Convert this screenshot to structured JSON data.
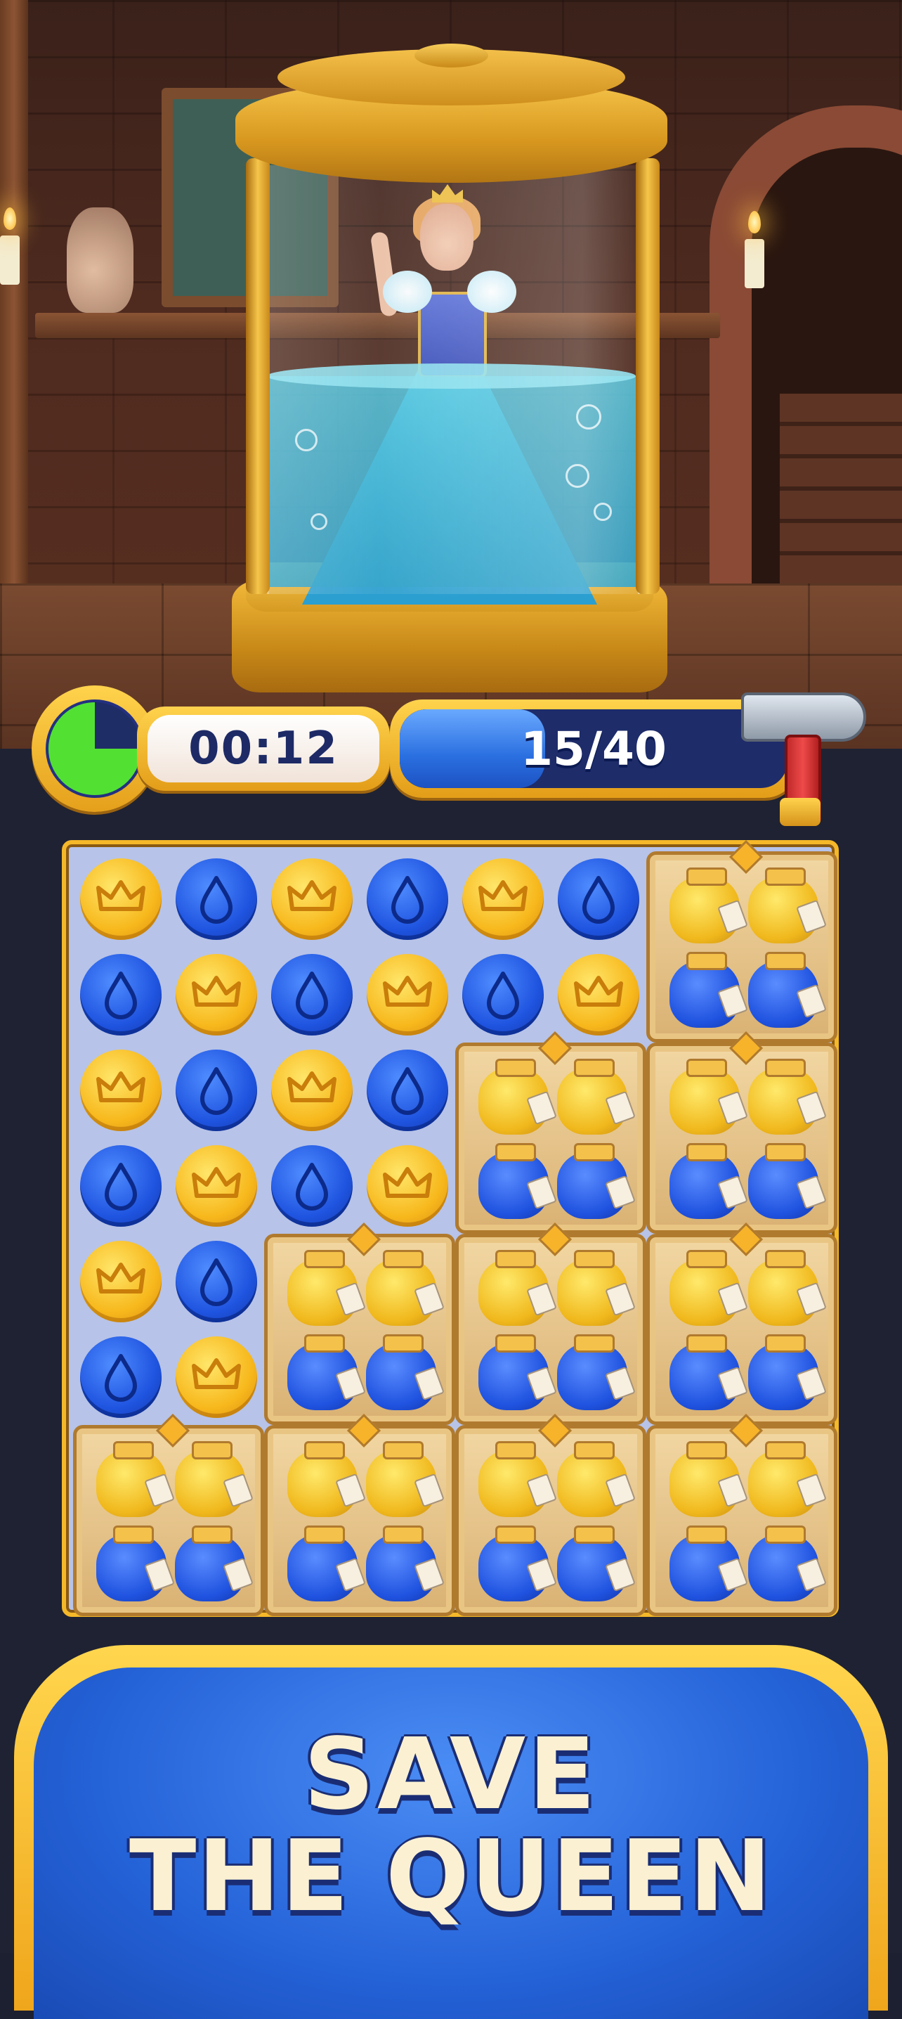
{
  "hud": {
    "timer_text": "00:12",
    "timer_remaining_fraction": 0.25,
    "progress_text": "15/40",
    "progress_current": 15,
    "progress_total": 40,
    "booster_icon": "hammer-icon"
  },
  "board": {
    "rows": 8,
    "cols": 8,
    "pieces": [
      {
        "r": 0,
        "c": 0,
        "t": "gold"
      },
      {
        "r": 0,
        "c": 1,
        "t": "blue"
      },
      {
        "r": 0,
        "c": 2,
        "t": "gold"
      },
      {
        "r": 0,
        "c": 3,
        "t": "blue"
      },
      {
        "r": 0,
        "c": 4,
        "t": "gold"
      },
      {
        "r": 0,
        "c": 5,
        "t": "blue"
      },
      {
        "r": 1,
        "c": 0,
        "t": "blue"
      },
      {
        "r": 1,
        "c": 1,
        "t": "gold"
      },
      {
        "r": 1,
        "c": 2,
        "t": "blue"
      },
      {
        "r": 1,
        "c": 3,
        "t": "gold"
      },
      {
        "r": 1,
        "c": 4,
        "t": "blue"
      },
      {
        "r": 1,
        "c": 5,
        "t": "gold"
      },
      {
        "r": 2,
        "c": 0,
        "t": "gold"
      },
      {
        "r": 2,
        "c": 1,
        "t": "blue"
      },
      {
        "r": 2,
        "c": 2,
        "t": "gold"
      },
      {
        "r": 2,
        "c": 3,
        "t": "blue"
      },
      {
        "r": 3,
        "c": 0,
        "t": "blue"
      },
      {
        "r": 3,
        "c": 1,
        "t": "gold"
      },
      {
        "r": 3,
        "c": 2,
        "t": "blue"
      },
      {
        "r": 3,
        "c": 3,
        "t": "gold"
      },
      {
        "r": 4,
        "c": 0,
        "t": "gold"
      },
      {
        "r": 4,
        "c": 1,
        "t": "blue"
      },
      {
        "r": 5,
        "c": 0,
        "t": "blue"
      },
      {
        "r": 5,
        "c": 1,
        "t": "gold"
      }
    ],
    "jars": [
      {
        "r": 0,
        "c": 6
      },
      {
        "r": 2,
        "c": 4
      },
      {
        "r": 2,
        "c": 6
      },
      {
        "r": 4,
        "c": 2
      },
      {
        "r": 4,
        "c": 4
      },
      {
        "r": 4,
        "c": 6
      },
      {
        "r": 6,
        "c": 0
      },
      {
        "r": 6,
        "c": 2
      },
      {
        "r": 6,
        "c": 4
      },
      {
        "r": 6,
        "c": 6
      }
    ],
    "piece_icons": {
      "gold": "crown-icon",
      "blue": "water-drop-icon"
    }
  },
  "banner": {
    "line1": "SAVE",
    "line2": "THE QUEEN"
  },
  "colors": {
    "gold": "#f7b81c",
    "blue": "#1f54e0",
    "frame": "#f5b829",
    "banner_blue": "#2462d8"
  }
}
